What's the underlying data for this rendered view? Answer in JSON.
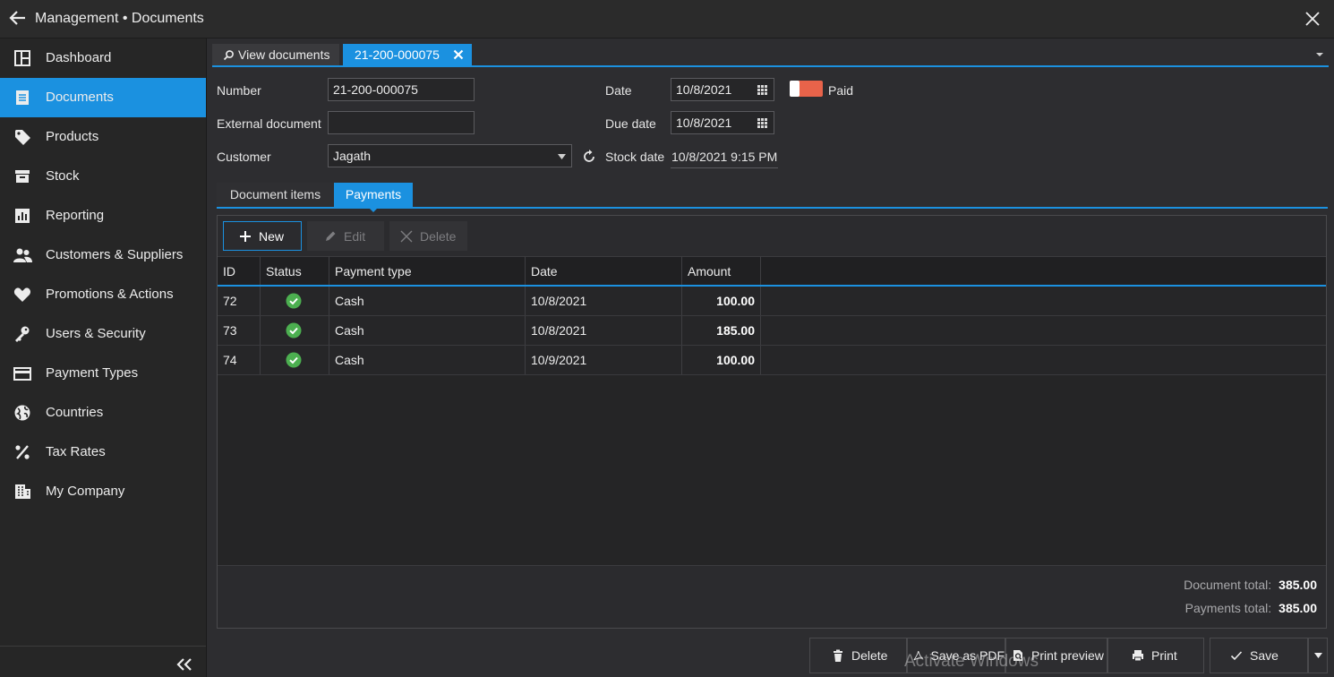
{
  "window": {
    "title": "Management • Documents",
    "back_icon": "arrow-left-icon",
    "close_icon": "close-icon"
  },
  "sidebar": {
    "items": [
      {
        "label": "Dashboard",
        "icon": "dashboard-icon"
      },
      {
        "label": "Documents",
        "icon": "document-icon",
        "active": true
      },
      {
        "label": "Products",
        "icon": "tag-icon"
      },
      {
        "label": "Stock",
        "icon": "archive-box-icon"
      },
      {
        "label": "Reporting",
        "icon": "bar-chart-icon"
      },
      {
        "label": "Customers & Suppliers",
        "icon": "users-icon"
      },
      {
        "label": "Promotions & Actions",
        "icon": "heart-icon"
      },
      {
        "label": "Users & Security",
        "icon": "key-icon"
      },
      {
        "label": "Payment Types",
        "icon": "credit-card-icon"
      },
      {
        "label": "Countries",
        "icon": "globe-icon"
      },
      {
        "label": "Tax Rates",
        "icon": "percent-icon"
      },
      {
        "label": "My Company",
        "icon": "building-icon"
      }
    ],
    "collapse_icon": "double-chevron-left-icon"
  },
  "doc_tabs": {
    "view_label": "View documents",
    "current_label": "21-200-000075"
  },
  "form": {
    "number_label": "Number",
    "number_value": "21-200-000075",
    "external_label": "External document",
    "external_value": "",
    "customer_label": "Customer",
    "customer_value": "Jagath",
    "date_label": "Date",
    "date_value": "10/8/2021",
    "due_label": "Due date",
    "due_value": "10/8/2021",
    "stock_label": "Stock date",
    "stock_value": "10/8/2021 9:15 PM",
    "paid_label": "Paid",
    "paid_on": true
  },
  "inner_tabs": {
    "items_label": "Document items",
    "payments_label": "Payments"
  },
  "toolbar": {
    "new_label": "New",
    "edit_label": "Edit",
    "delete_label": "Delete"
  },
  "grid": {
    "columns": [
      "ID",
      "Status",
      "Payment type",
      "Date",
      "Amount"
    ],
    "rows": [
      {
        "id": "72",
        "status": "ok",
        "type": "Cash",
        "date": "10/8/2021",
        "amount": "100.00"
      },
      {
        "id": "73",
        "status": "ok",
        "type": "Cash",
        "date": "10/8/2021",
        "amount": "185.00"
      },
      {
        "id": "74",
        "status": "ok",
        "type": "Cash",
        "date": "10/9/2021",
        "amount": "100.00"
      }
    ]
  },
  "totals": {
    "document_label": "Document total:",
    "document_value": "385.00",
    "payments_label": "Payments total:",
    "payments_value": "385.00"
  },
  "actions": {
    "delete_label": "Delete",
    "pdf_label": "Save as PDF",
    "preview_label": "Print preview",
    "print_label": "Print",
    "save_label": "Save"
  },
  "watermark": "Activate Windows",
  "colors": {
    "accent": "#1b91e0",
    "paid_toggle": "#e8634a",
    "status_ok": "#4caf50"
  }
}
